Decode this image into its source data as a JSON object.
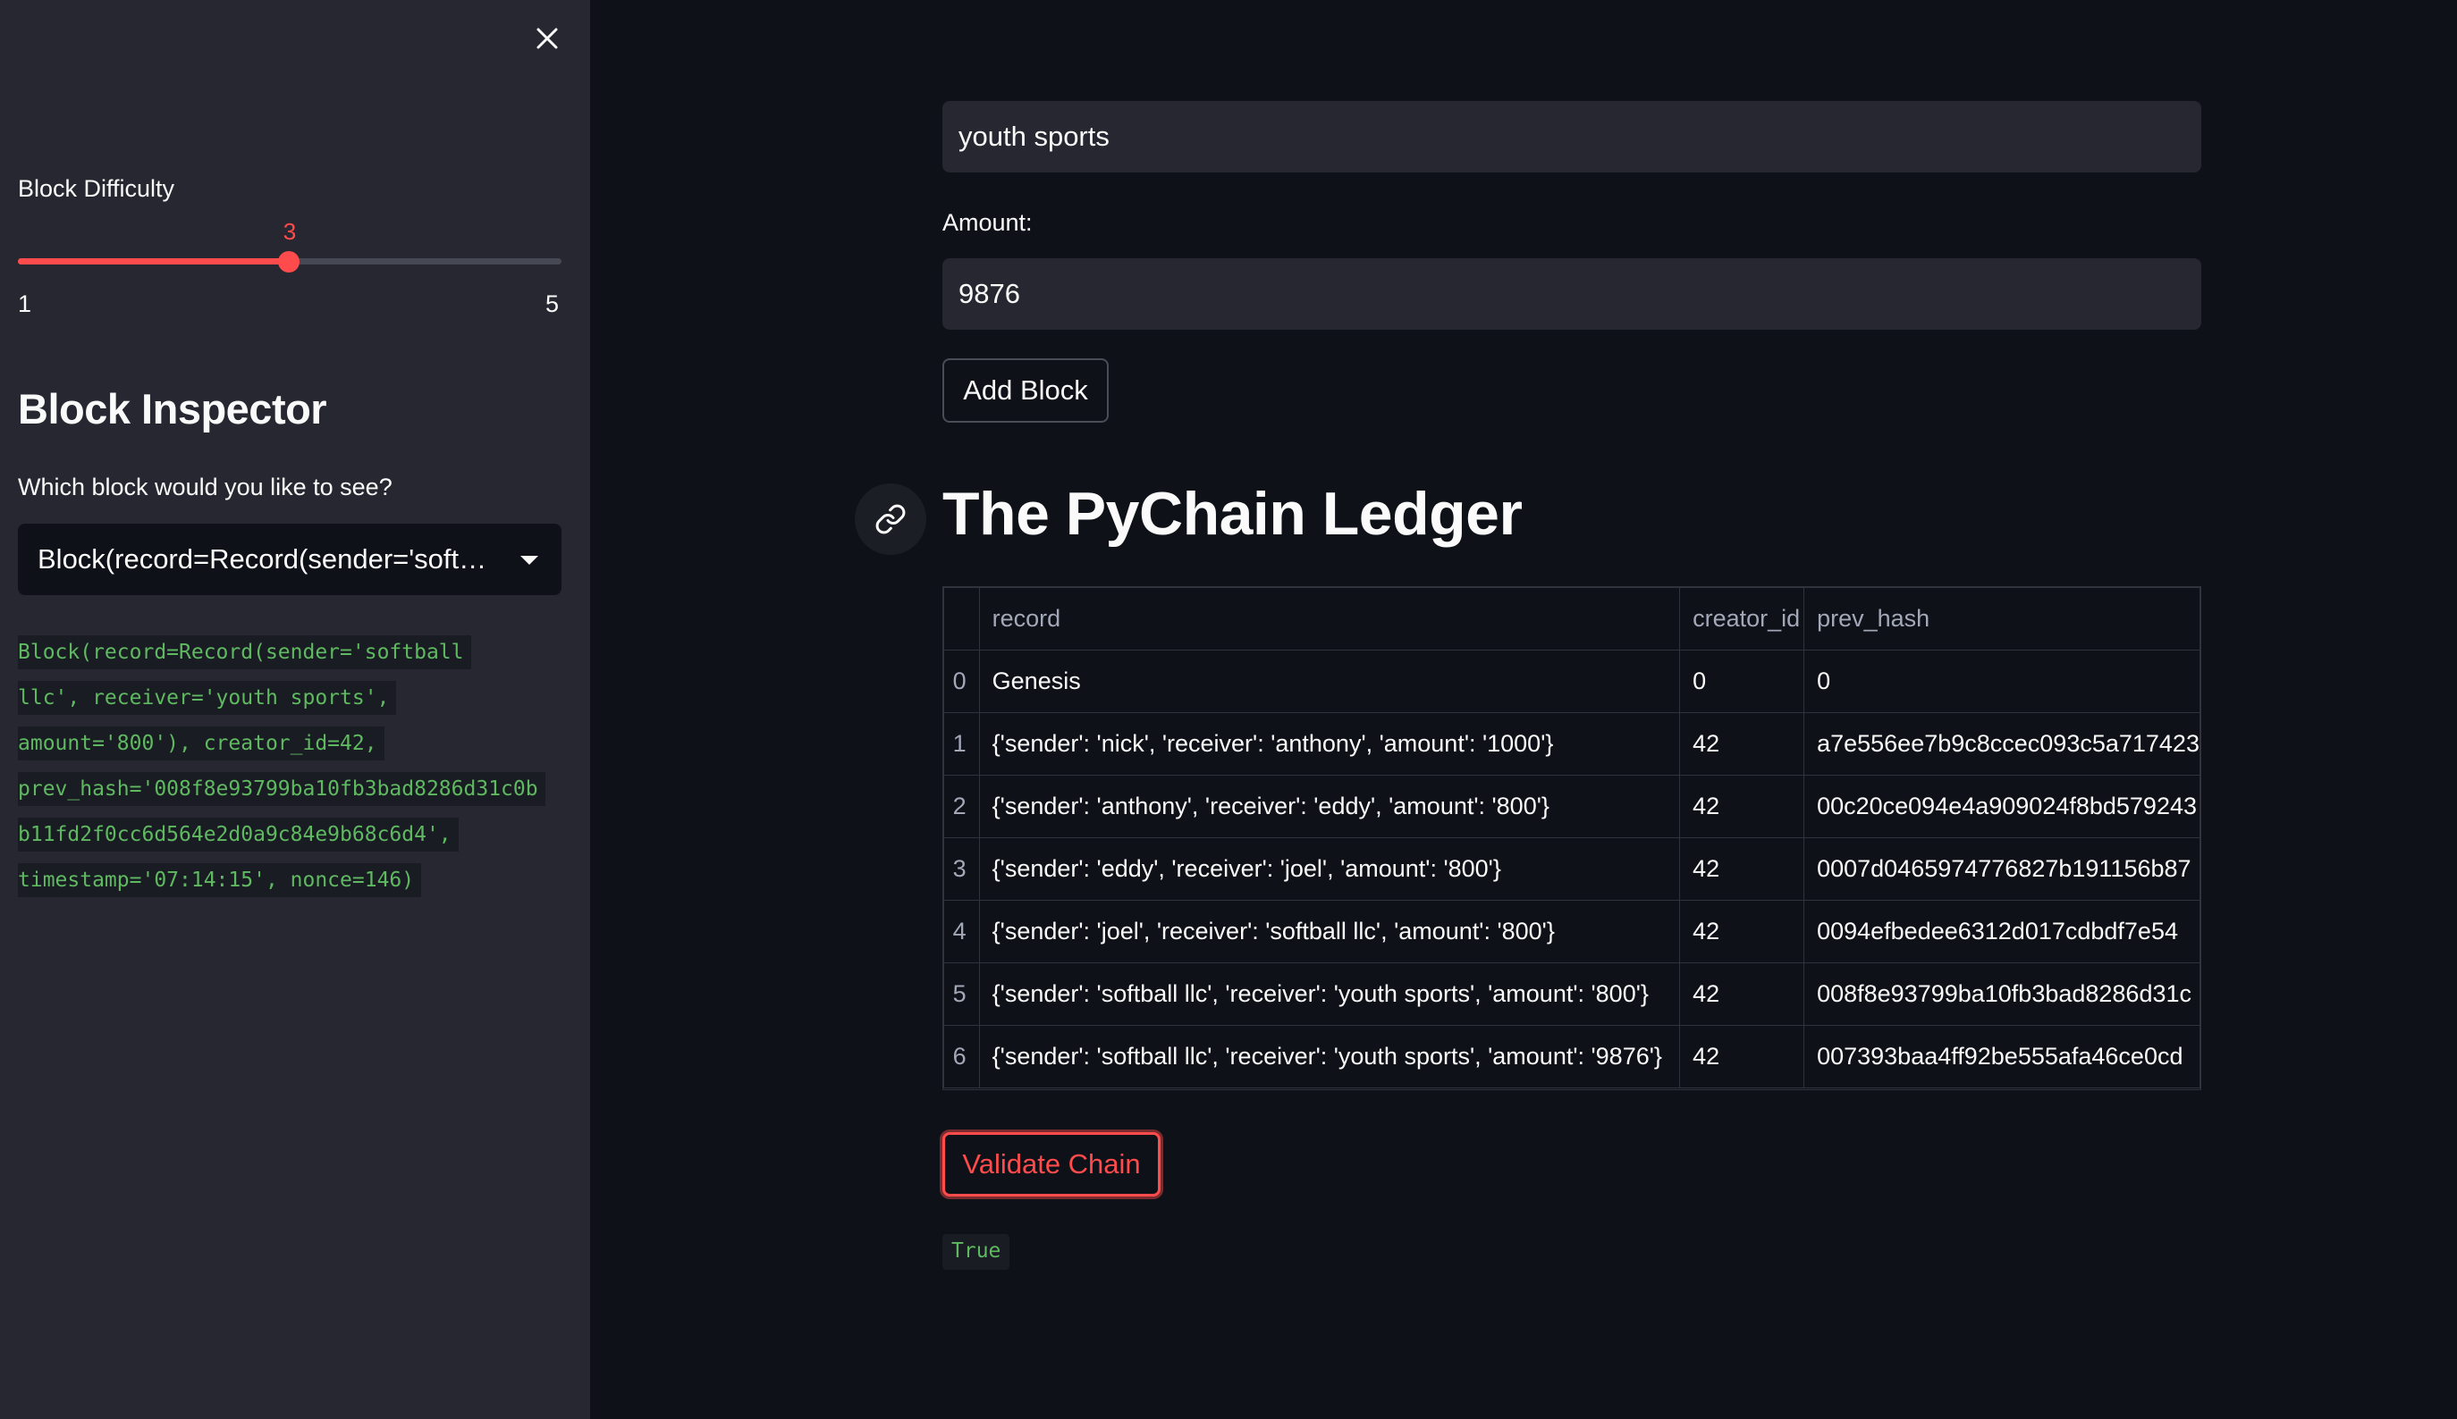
{
  "sidebar": {
    "slider": {
      "label": "Block Difficulty",
      "value": "3",
      "value_fraction": 0.5,
      "min": "1",
      "max": "5",
      "accent_color": "#ff4b4b"
    },
    "heading": "Block Inspector",
    "select_label": "Which block would you like to see?",
    "select_value": "Block(record=Record(sender='softball llc', receiver='youth sports', amount='800'), creator_id=42, prev_hash='008f8e93799ba10fb3bad8286d31c0bb11fd2f0cc6d564e2d0a9c84e9b68c6d4', timestamp='07:14:15', nonce=146)",
    "code_lines": [
      "Block(record=Record(sender='softball",
      "llc', receiver='youth sports',",
      "amount='800'), creator_id=42,",
      "prev_hash='008f8e93799ba10fb3bad8286d31c0b",
      "b11fd2f0cc6d564e2d0a9c84e9b68c6d4',",
      "timestamp='07:14:15', nonce=146)"
    ]
  },
  "main": {
    "receiver_value": "youth sports",
    "amount_label": "Amount:",
    "amount_value": "9876",
    "add_button": "Add Block",
    "ledger_heading": "The PyChain Ledger",
    "table": {
      "columns": [
        "",
        "record",
        "creator_id",
        "prev_hash"
      ],
      "rows": [
        [
          "0",
          "Genesis",
          "0",
          "0"
        ],
        [
          "1",
          "{'sender': 'nick', 'receiver': 'anthony', 'amount': '1000'}",
          "42",
          "a7e556ee7b9c8ccec093c5a717423"
        ],
        [
          "2",
          "{'sender': 'anthony', 'receiver': 'eddy', 'amount': '800'}",
          "42",
          "00c20ce094e4a909024f8bd579243"
        ],
        [
          "3",
          "{'sender': 'eddy', 'receiver': 'joel', 'amount': '800'}",
          "42",
          "0007d0465974776827b191156b87"
        ],
        [
          "4",
          "{'sender': 'joel', 'receiver': 'softball llc', 'amount': '800'}",
          "42",
          "0094efbedee6312d017cdbdf7e54"
        ],
        [
          "5",
          "{'sender': 'softball llc', 'receiver': 'youth sports', 'amount': '800'}",
          "42",
          "008f8e93799ba10fb3bad8286d31c"
        ],
        [
          "6",
          "{'sender': 'softball llc', 'receiver': 'youth sports', 'amount': '9876'}",
          "42",
          "007393baa4ff92be555afa46ce0cd"
        ]
      ]
    },
    "validate_button": "Validate Chain",
    "validation_result": "True"
  },
  "colors": {
    "background": "#0e1117",
    "sidebar": "#262730",
    "accent": "#ff4b4b",
    "code_green": "#5fb960"
  },
  "icons": {
    "close": "close-icon",
    "link": "link-icon",
    "caret": "chevron-down-icon"
  }
}
